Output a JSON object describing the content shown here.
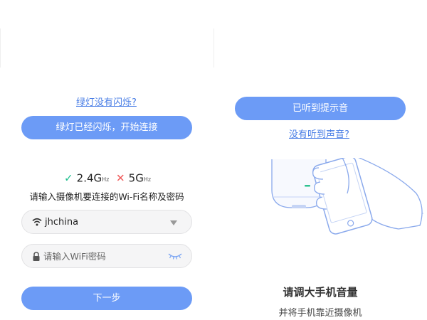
{
  "left": {
    "no_blink_link": "绿灯没有闪烁?",
    "blinking_button": "绿灯已经闪烁，开始连接",
    "bands": {
      "band_24": {
        "status": "supported",
        "value": "2.4G",
        "unit": "Hz"
      },
      "band_5": {
        "status": "unsupported",
        "value": "5G",
        "unit": "Hz"
      }
    },
    "wifi_hint": "请输入摄像机要连接的Wi-Fi名称及密码",
    "ssid": "jhchina",
    "password_placeholder": "请输入WiFi密码",
    "next_button": "下一步"
  },
  "right": {
    "heard_button": "已听到提示音",
    "not_heard_link": "没有听到声音?",
    "instruction_title": "请调大手机音量",
    "instruction_subtitle": "并将手机靠近摄像机"
  },
  "colors": {
    "accent": "#6c9bf6",
    "link": "#4b7fe6",
    "check": "#1fbf8f",
    "cross": "#f05a5a"
  },
  "icons": {
    "band_24": "check-icon",
    "band_5": "cross-icon",
    "ssid_field": "wifi-icon",
    "password_field": "lock-icon",
    "password_toggle": "eye-closed-icon",
    "ssid_dropdown": "dropdown-arrow-icon"
  }
}
